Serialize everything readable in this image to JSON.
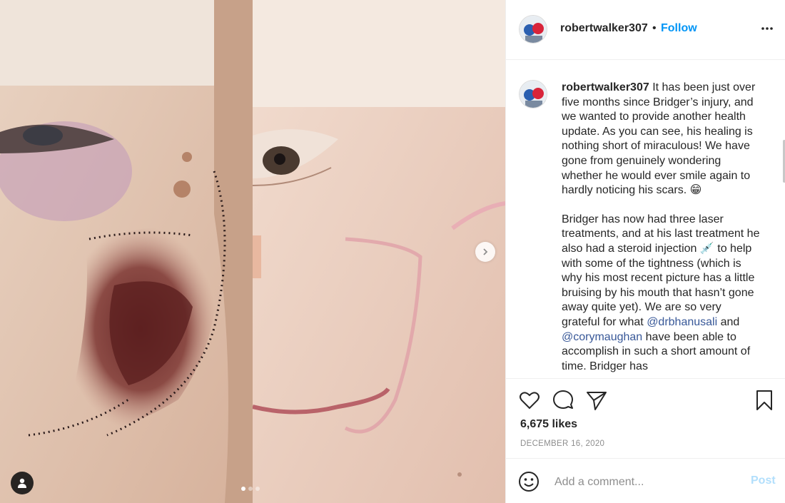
{
  "post": {
    "username": "robertwalker307",
    "follow_separator": "•",
    "follow_label": "Follow",
    "caption_paragraphs": [
      "It has been just over five months since Bridger’s injury, and we wanted to provide another health update. As you can see, his healing is nothing short of miraculous! We have gone from genuinely wondering whether he would ever smile again to hardly noticing his scars. 😁",
      "Bridger has now had three laser treatments, and at his last treatment he also had a steroid injection 💉 to help with some of the tightness (which is why his most recent picture has a little bruising by his mouth that hasn’t gone away quite yet). We are so very grateful for what",
      "have been able to accomplish in such a short amount of time. Bridger has"
    ],
    "mentions": [
      "@drbhanusali",
      "@corymaughan"
    ],
    "mention_joiner": "and",
    "likes": "6,675 likes",
    "date": "DECEMBER 16, 2020",
    "comment_placeholder": "Add a comment...",
    "post_label": "Post"
  },
  "carousel": {
    "slide_count": 3,
    "active_slide": 1
  },
  "icons": {
    "more": "more-options-icon",
    "like": "heart-icon",
    "comment": "comment-icon",
    "share": "share-icon",
    "save": "bookmark-icon",
    "emoji": "emoji-icon",
    "next": "chevron-right-icon",
    "tag": "user-tag-icon"
  },
  "colors": {
    "accent": "#0095f6",
    "mention": "#385898",
    "muted": "#8e8e8e",
    "post_disabled": "#b2dffc"
  }
}
